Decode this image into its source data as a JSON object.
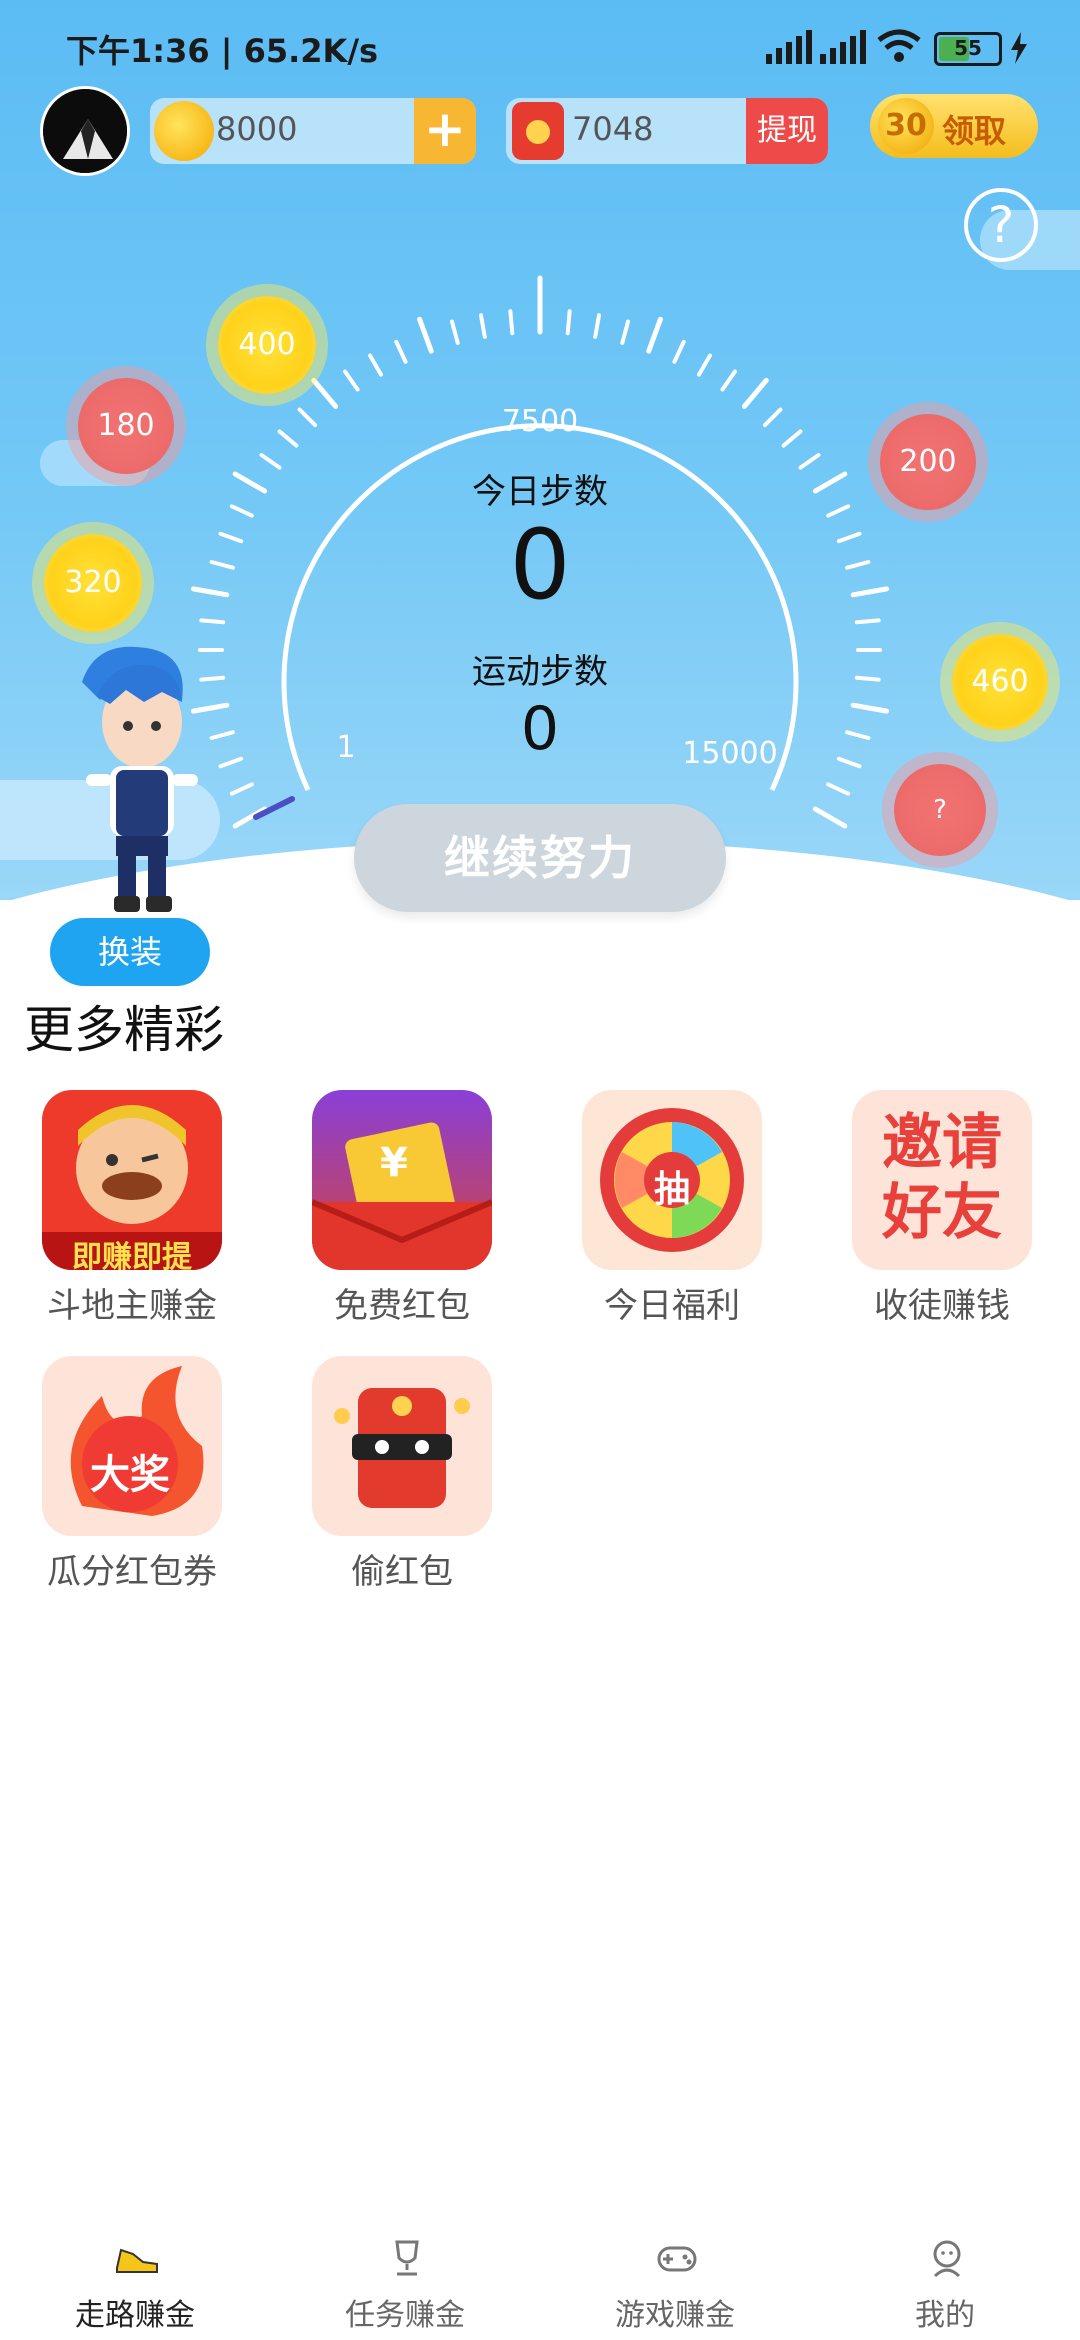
{
  "status_bar": {
    "time": "下午1:36 | 65.2K/s",
    "battery": "55"
  },
  "header": {
    "coins": "8000",
    "coins_add": "+",
    "cash": "7048",
    "withdraw_label": "提现",
    "claim_count": "30",
    "claim_label": "领取",
    "help_label": "?"
  },
  "bubbles": [
    "400",
    "180",
    "320",
    "200",
    "460",
    "?"
  ],
  "pedometer": {
    "tick_max_label": "7500",
    "today_label": "今日步数",
    "today_value": "0",
    "sport_label": "运动步数",
    "sport_value": "0",
    "min_label": "1",
    "max_label": "15000",
    "progress": 0
  },
  "continue_label": "继续努力",
  "change_outfit_label": "换装",
  "more_title": "更多精彩",
  "apps": [
    {
      "name": "斗地主赚金",
      "badge": "即赚即提"
    },
    {
      "name": "免费红包",
      "badge": "¥"
    },
    {
      "name": "今日福利",
      "badge": "抽"
    },
    {
      "name": "收徒赚钱",
      "badge": "邀请好友"
    },
    {
      "name": "瓜分红包券",
      "badge": "大奖"
    },
    {
      "name": "偷红包",
      "badge": ""
    }
  ],
  "tabs": [
    {
      "label": "走路赚金"
    },
    {
      "label": "任务赚金"
    },
    {
      "label": "游戏赚金"
    },
    {
      "label": "我的"
    }
  ]
}
